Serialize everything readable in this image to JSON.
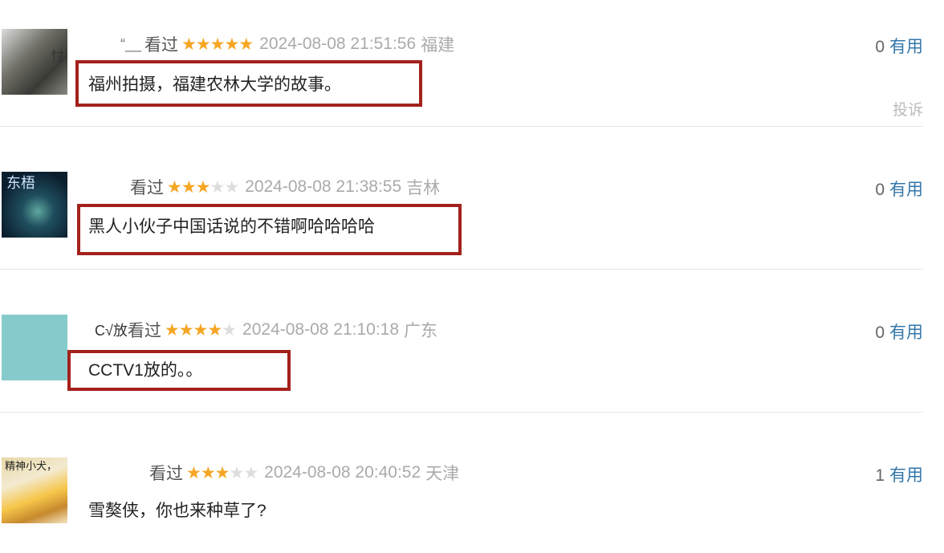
{
  "comments": [
    {
      "username": "“__",
      "watched": "看过",
      "rating": 5,
      "time": "2024-08-08 21:51:56",
      "region": "福建",
      "useful_count": "0",
      "useful_label": "有用",
      "text": "福州拍摄，福建农林大学的故事。",
      "highlighted": true,
      "report_label": "投诉"
    },
    {
      "username": "",
      "watched": "看过",
      "rating": 3,
      "time": "2024-08-08 21:38:55",
      "region": "吉林",
      "useful_count": "0",
      "useful_label": "有用",
      "text": "黑人小伙子中国话说的不错啊哈哈哈哈",
      "highlighted": true
    },
    {
      "username": "C√放",
      "watched": "看过",
      "rating": 4,
      "time": "2024-08-08 21:10:18",
      "region": "广东",
      "useful_count": "0",
      "useful_label": "有用",
      "text": "CCTV1放的。。",
      "highlighted": true
    },
    {
      "username": "",
      "watched": "看过",
      "rating": 3,
      "time": "2024-08-08 20:40:52",
      "region": "天津",
      "useful_count": "1",
      "useful_label": "有用",
      "text": "雪獒侠，你也来种草了?",
      "highlighted": false
    }
  ],
  "avatars": {
    "c0": "忖",
    "c1": "东梧",
    "c3": "精神小犬，"
  },
  "colors": {
    "star_on": "#f5a623",
    "star_off": "#dddddd",
    "highlight_border": "#a3211c",
    "link": "#3377aa"
  }
}
